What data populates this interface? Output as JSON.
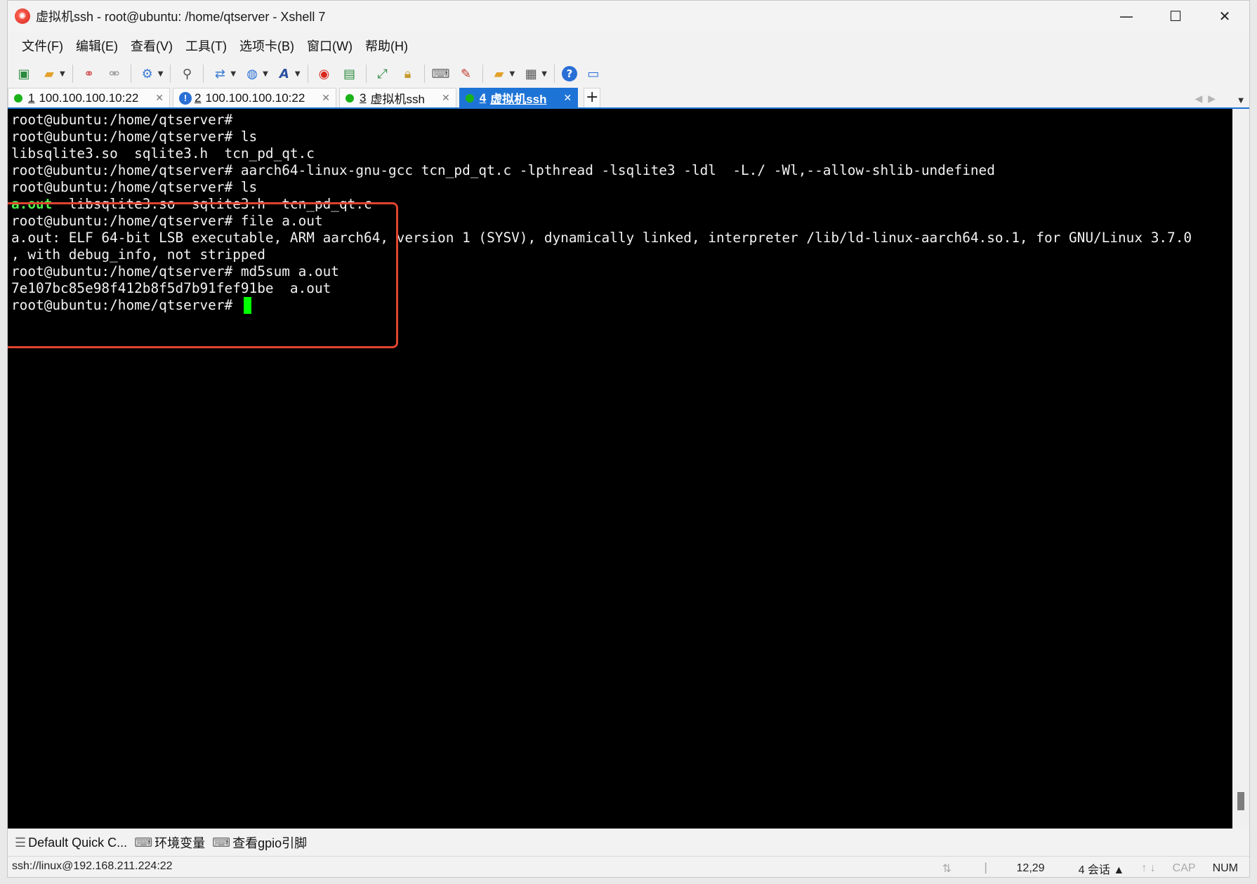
{
  "window": {
    "title": "虚拟机ssh - root@ubuntu: /home/qtserver - Xshell 7",
    "minimize": "—",
    "maximize": "☐",
    "close": "✕"
  },
  "menu": [
    "文件(F)",
    "编辑(E)",
    "查看(V)",
    "工具(T)",
    "选项卡(B)",
    "窗口(W)",
    "帮助(H)"
  ],
  "tabs": [
    {
      "num": "1",
      "label": "100.100.100.10:22",
      "status": "connected"
    },
    {
      "num": "2",
      "label": "100.100.100.10:22",
      "status": "warning"
    },
    {
      "num": "3",
      "label": "虚拟机ssh",
      "status": "connected"
    },
    {
      "num": "4",
      "label": "虚拟机ssh",
      "status": "connected",
      "active": true
    }
  ],
  "tab_add": "+",
  "terminal": {
    "lines": [
      "root@ubuntu:/home/qtserver#",
      "root@ubuntu:/home/qtserver# ls",
      "libsqlite3.so  sqlite3.h  tcn_pd_qt.c",
      "root@ubuntu:/home/qtserver# aarch64-linux-gnu-gcc tcn_pd_qt.c -lpthread -lsqlite3 -ldl  -L./ -Wl,--allow-shlib-undefined",
      "root@ubuntu:/home/qtserver# ls",
      "  libsqlite3.so  sqlite3.h  tcn_pd_qt.c",
      "root@ubuntu:/home/qtserver# file a.out",
      "a.out: ELF 64-bit LSB executable, ARM aarch64, version 1 (SYSV), dynamically linked, interpreter /lib/ld-linux-aarch64.so.1, for GNU/Linux 3.7.0",
      ", with debug_info, not stripped",
      "root@ubuntu:/home/qtserver# md5sum a.out",
      "7e107bc85e98f412b8f5d7b91fef91be  a.out",
      "root@ubuntu:/home/qtserver# "
    ],
    "green_file": "a.out"
  },
  "quickbar": {
    "items": [
      "Default Quick C...",
      "环境变量",
      "查看gpio引脚"
    ]
  },
  "status": {
    "connection": "ssh://linux@192.168.211.224:22",
    "cursor_pos": "12,29",
    "sessions": "4 会话",
    "cap": "CAP",
    "num": "NUM"
  }
}
